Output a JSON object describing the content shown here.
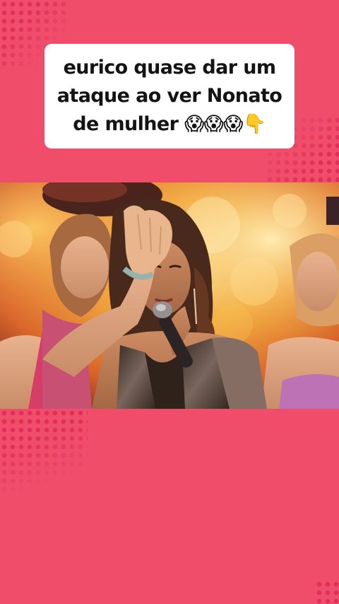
{
  "caption": {
    "text": "eurico quase dar um ataque ao ver Nonato de mulher 😱😱😱👇"
  },
  "colors": {
    "background": "#f04d6b",
    "dot_pattern": "#e0305a",
    "caption_card": "#ffffff",
    "caption_text": "#141414"
  },
  "video": {
    "subject": "performer-singing-on-stage-with-microphone"
  }
}
